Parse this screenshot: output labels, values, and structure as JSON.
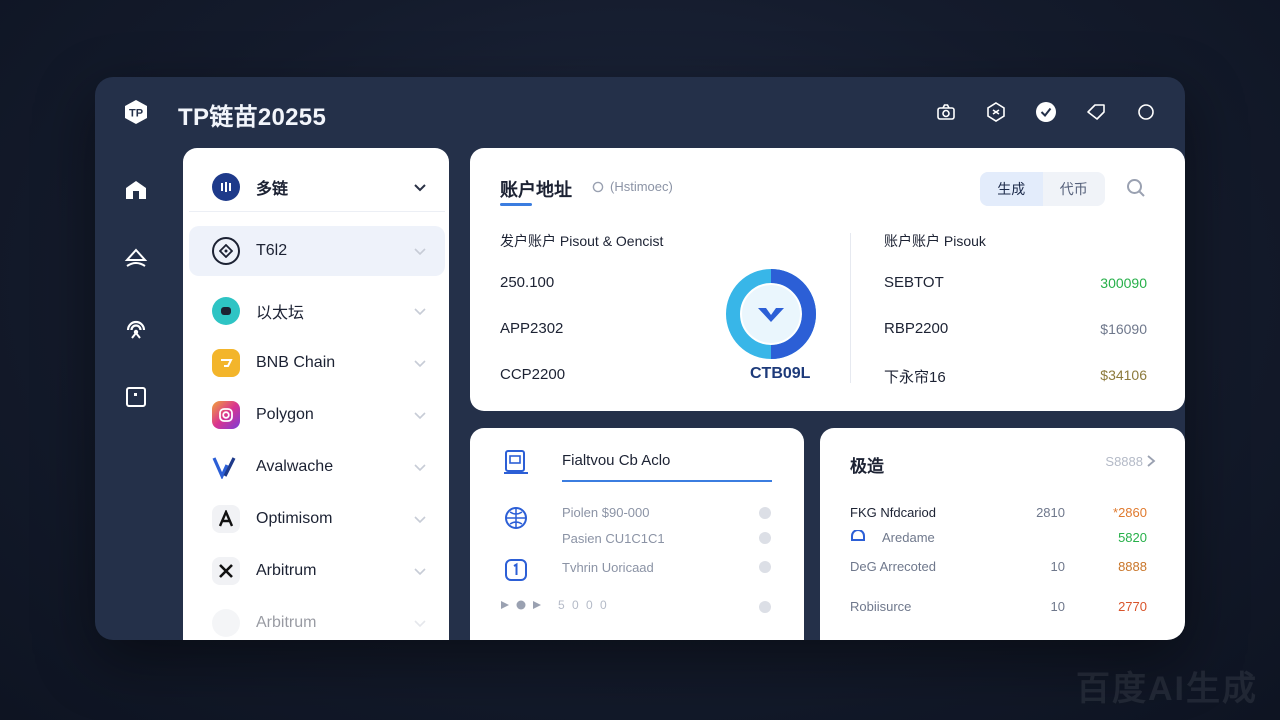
{
  "app": {
    "title": "TP链苗20255"
  },
  "chains": {
    "header": {
      "label": "多链"
    },
    "items": [
      {
        "label": "T6l2"
      },
      {
        "label": "以太坛"
      },
      {
        "label": "BNB Chain"
      },
      {
        "label": "Polygon"
      },
      {
        "label": "Avalwache"
      },
      {
        "label": "Optimisom"
      },
      {
        "label": "Arbitrum"
      },
      {
        "label": "Arbitrum"
      }
    ]
  },
  "account": {
    "title": "账户地址",
    "subtitle": "(Hstimoec)",
    "segment": {
      "left": "生成",
      "right": "代币"
    },
    "left_column_label": "发户账户 Pisout & Oencist",
    "left_rows": [
      "250.100",
      "APP2302",
      "CCP2200"
    ],
    "gauge_label": "CTB09L",
    "right_column_label": "账户账户 Pisouk",
    "right_rows": [
      {
        "name": "SEBTOT",
        "value": "300090",
        "color": "#27b04a"
      },
      {
        "name": "RBP2200",
        "value": "$16090",
        "color": "#6f788c"
      },
      {
        "name": "下永帘16",
        "value": "$34106",
        "color": "#8c7a3c"
      }
    ]
  },
  "activity": {
    "title": "Fialtvou Cb Aclo",
    "rows": [
      "Piolen  $90-000",
      "Pasien  CU1C1C1",
      "Tvhrin  Uoricaad"
    ],
    "media_text": "5 0 0 0"
  },
  "rank": {
    "title": "极造",
    "more": "S8888",
    "rows": [
      {
        "name": "FKG  Nfdcariod",
        "num": "2810",
        "value": "*2860",
        "color": "#e07a2e"
      },
      {
        "name": "Aredame",
        "num": "",
        "value": "5820",
        "color": "#27b04a"
      },
      {
        "name": "DeG  Arrecoted",
        "num": "10",
        "value": "8888",
        "color": "#c9762a"
      },
      {
        "name": "Robiisurce",
        "num": "10",
        "value": "2770",
        "color": "#d9542b"
      }
    ]
  }
}
